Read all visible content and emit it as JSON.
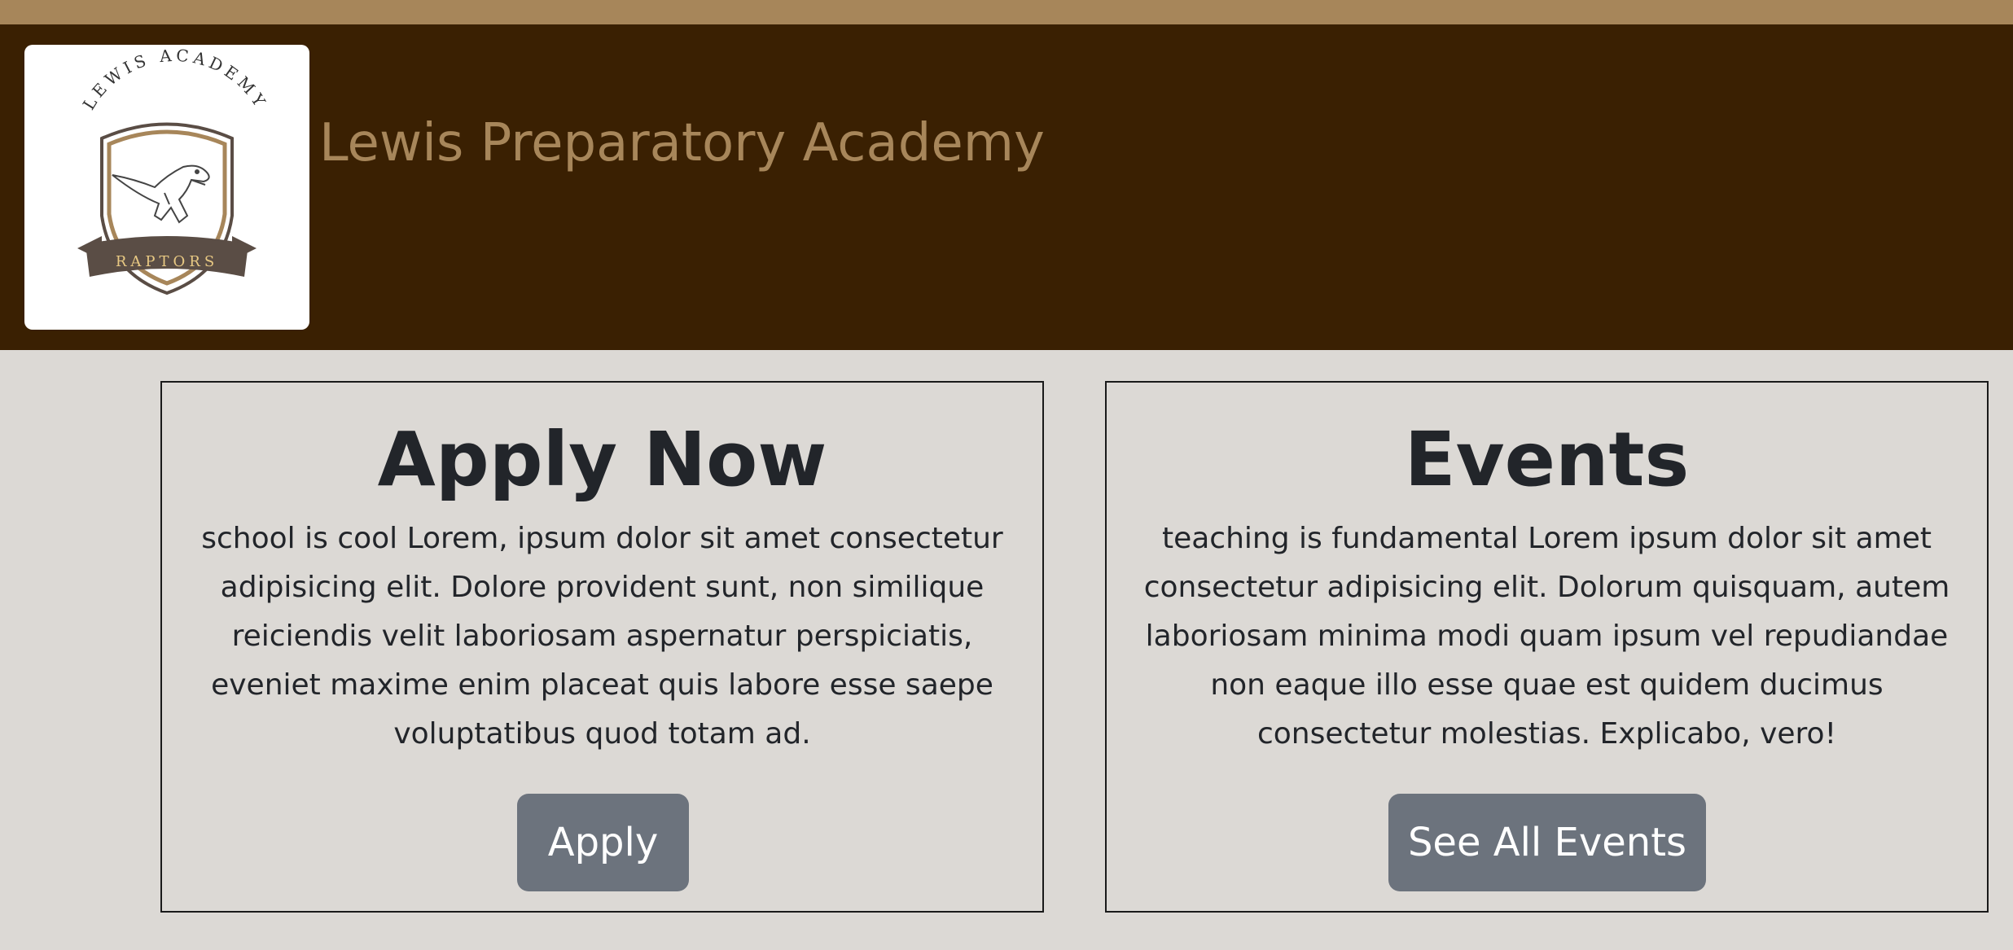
{
  "header": {
    "site_title": "Lewis Preparatory Academy",
    "logo": {
      "arc_text": "LEWIS ACADEMY",
      "banner_text": "RAPTORS"
    }
  },
  "cards": [
    {
      "title": "Apply Now",
      "body": "school is cool Lorem, ipsum dolor sit amet consectetur adipisicing elit. Dolore provident sunt, non similique reiciendis velit laboriosam aspernatur perspiciatis, eveniet maxime enim placeat quis labore esse saepe voluptatibus quod totam ad.",
      "button_label": "Apply"
    },
    {
      "title": "Events",
      "body": "teaching is fundamental Lorem ipsum dolor sit amet consectetur adipisicing elit. Dolorum quisquam, autem laboriosam minima modi quam ipsum vel repudiandae non eaque illo esse quae est quidem ducimus consectetur molestias. Explicabo, vero!",
      "button_label": "See All Events"
    }
  ],
  "colors": {
    "top_strip": "#a7865a",
    "header_bg": "#3a2002",
    "title_text": "#a7865a",
    "page_bg": "#dcd9d5",
    "button_bg": "#6c737d"
  }
}
